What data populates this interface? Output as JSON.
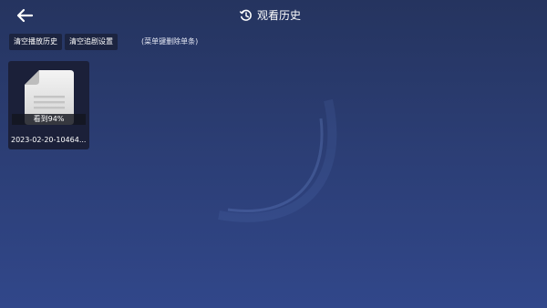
{
  "header": {
    "back_icon": "arrow-left-icon",
    "title_icon": "history-icon",
    "title": "观看历史"
  },
  "toolbar": {
    "clear_history_label": "清空播放历史",
    "clear_follow_label": "清空追剧设置",
    "hint": "(菜单键删除单条)"
  },
  "history": {
    "items": [
      {
        "thumbnail_icon": "document-icon",
        "progress": "看到94%",
        "progress_percent": 94,
        "title": "2023-02-20-10464..."
      }
    ]
  },
  "colors": {
    "background": "#2b3d73",
    "button_bg": "#1c2440",
    "card_bg": "#1b2039"
  }
}
